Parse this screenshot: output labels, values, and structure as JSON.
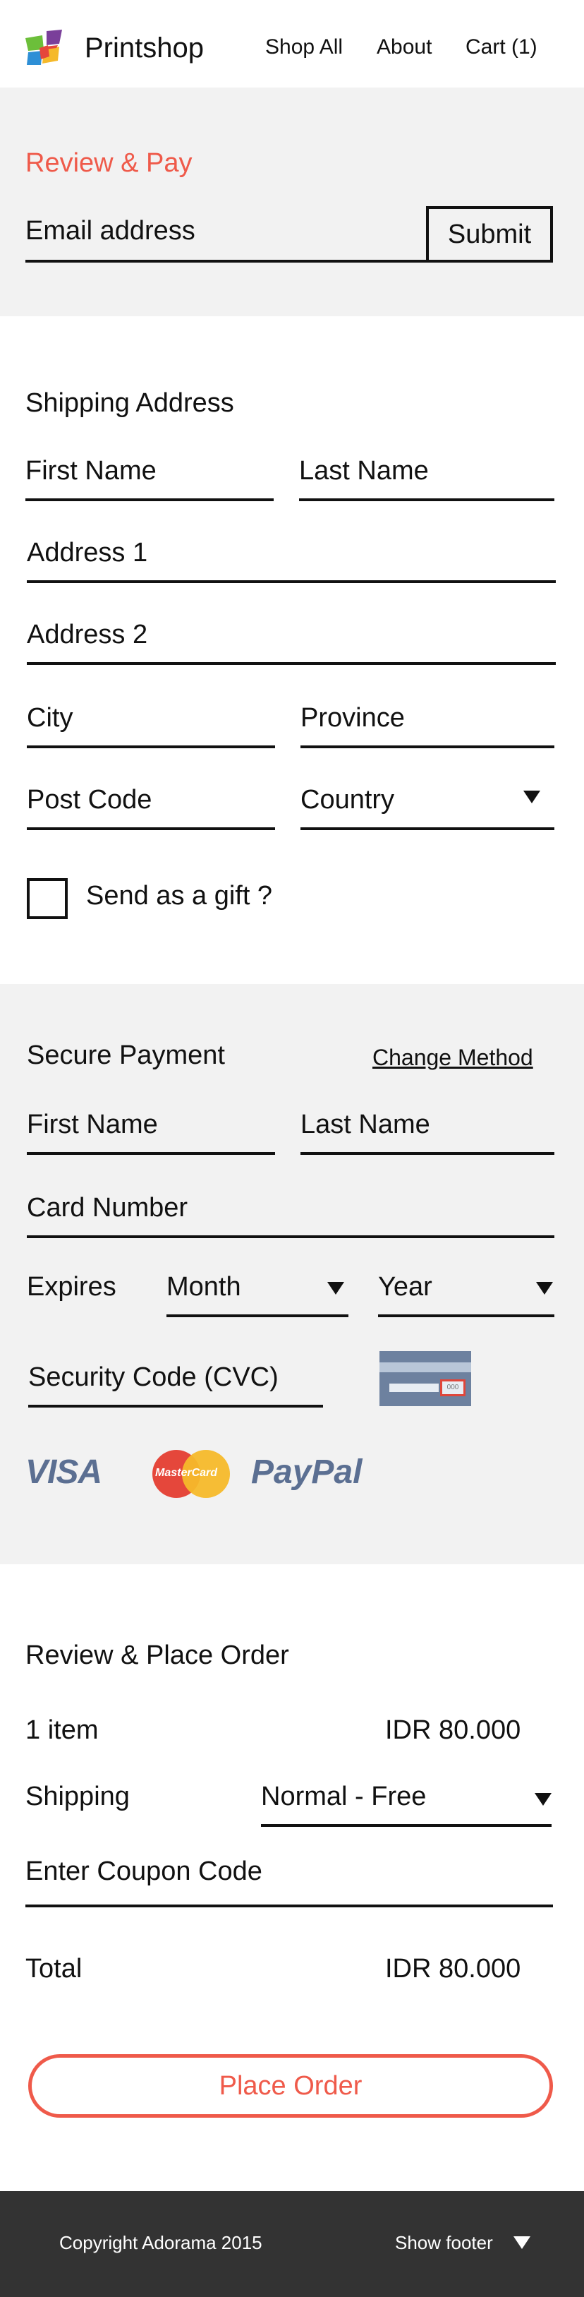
{
  "header": {
    "brand": "Printshop",
    "nav": [
      "Shop All",
      "About",
      "Cart (1)"
    ]
  },
  "review_pay": {
    "title": "Review & Pay",
    "email_placeholder": "Email address",
    "submit_label": "Submit"
  },
  "shipping": {
    "title": "Shipping Address",
    "first_name": "First Name",
    "last_name": "Last Name",
    "address1": "Address 1",
    "address2": "Address 2",
    "city": "City",
    "province": "Province",
    "post_code": "Post Code",
    "country": "Country",
    "gift_label": "Send as a gift ?"
  },
  "payment": {
    "title": "Secure Payment",
    "change_method": "Change Method",
    "first_name": "First Name",
    "last_name": "Last Name",
    "card_number": "Card Number",
    "expires": "Expires",
    "month": "Month",
    "year": "Year",
    "security_code": "Security Code (CVC)",
    "card_cvc_text": "000",
    "logos": [
      "VISA",
      "MasterCard",
      "PayPal"
    ]
  },
  "order": {
    "title": "Review & Place Order",
    "items_label": "1 item",
    "items_price": "IDR 80.000",
    "shipping_label": "Shipping",
    "shipping_option": "Normal - Free",
    "coupon_placeholder": "Enter Coupon Code",
    "total_label": "Total",
    "total_price": "IDR 80.000",
    "place_order": "Place Order"
  },
  "footer": {
    "copyright": "Copyright Adorama 2015",
    "show_footer": "Show footer"
  },
  "colors": {
    "accent": "#ef5a4a",
    "gray_bg": "#f2f2f2",
    "footer_bg": "#333333"
  }
}
